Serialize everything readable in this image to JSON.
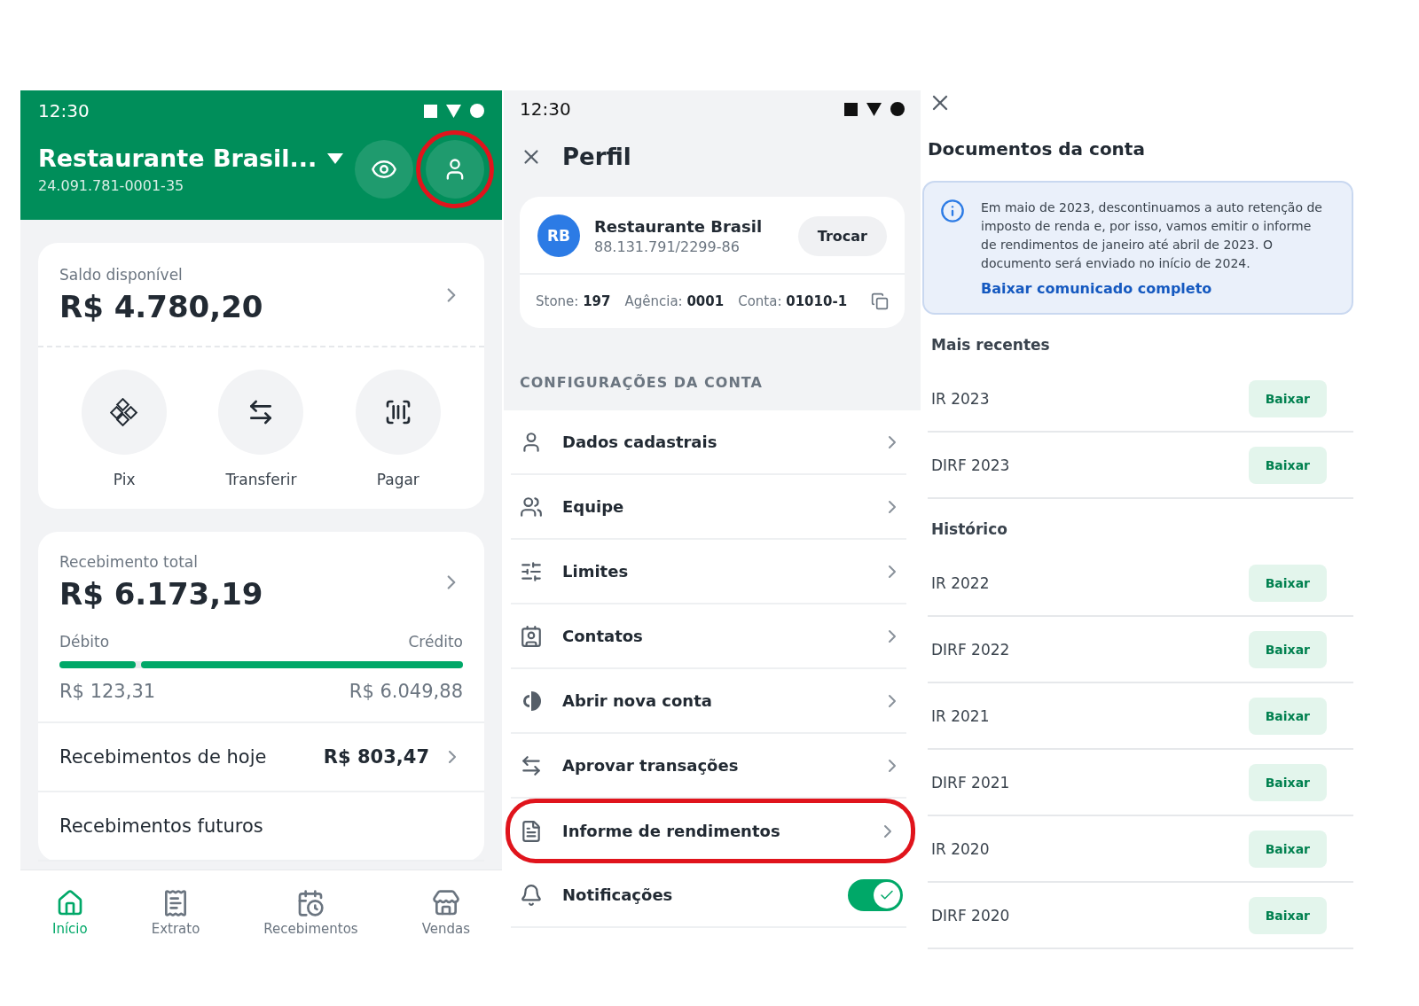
{
  "home": {
    "status_time": "12:30",
    "business_name": "Restaurante Brasil...",
    "document": "24.091.781-0001-35",
    "header_buttons": [
      {
        "kind": "eye",
        "highlighted": false
      },
      {
        "kind": "profile",
        "highlighted": true
      }
    ],
    "balance": {
      "label": "Saldo disponível",
      "amount": "R$ 4.780,20"
    },
    "actions": [
      {
        "kind": "pix",
        "label": "Pix"
      },
      {
        "kind": "transfer",
        "label": "Transferir"
      },
      {
        "kind": "pay",
        "label": "Pagar"
      }
    ],
    "receipts": {
      "label": "Recebimento total",
      "amount": "R$ 6.173,19",
      "debit_label": "Débito",
      "credit_label": "Crédito",
      "level": 0.19,
      "debit_amount": "R$ 123,31",
      "credit_amount": "R$ 6.049,88",
      "rows": [
        {
          "label": "Recebimentos de hoje",
          "value": "R$ 803,47"
        },
        {
          "label": "Recebimentos futuros"
        }
      ]
    },
    "nav": [
      {
        "kind": "home",
        "label": "Início",
        "selected": true
      },
      {
        "kind": "statement",
        "label": "Extrato",
        "selected": false
      },
      {
        "kind": "calendar",
        "label": "Recebimentos",
        "selected": false
      },
      {
        "kind": "store",
        "label": "Vendas",
        "selected": false
      }
    ]
  },
  "profile": {
    "status_time": "12:30",
    "title": "Perfil",
    "account": {
      "initials": "RB",
      "name": "Restaurante Brasil",
      "document": "88.131.791/2299-86",
      "switch_button": "Trocar",
      "details": [
        {
          "label": "Stone:",
          "value": "197"
        },
        {
          "label": "Agência:",
          "value": "0001"
        },
        {
          "label": "Conta:",
          "value": "01010-1"
        }
      ]
    },
    "section_title": "CONFIGURAÇÕES DA CONTA",
    "items": [
      {
        "kind": "link",
        "label": "Dados cadastrais",
        "highlighted": false
      },
      {
        "kind": "link",
        "label": "Equipe",
        "highlighted": false
      },
      {
        "kind": "link",
        "label": "Limites",
        "highlighted": false
      },
      {
        "kind": "link",
        "label": "Contatos",
        "highlighted": false
      },
      {
        "kind": "link",
        "label": "Abrir nova conta",
        "highlighted": false
      },
      {
        "kind": "link",
        "label": "Aprovar transações",
        "highlighted": false
      },
      {
        "kind": "link",
        "label": "Informe de rendimentos",
        "highlighted": true
      },
      {
        "kind": "toggle",
        "label": "Notificações",
        "on": true,
        "highlighted": false
      }
    ]
  },
  "documents": {
    "title": "Documentos da conta",
    "notice": {
      "text": "Em maio de 2023, descontinuamos a auto retenção de imposto de renda e, por isso, vamos emitir o informe de rendimentos de janeiro até abril de 2023. O documento será enviado no início de 2024.",
      "link": "Baixar comunicado completo"
    },
    "groups": [
      {
        "title": "Mais recentes",
        "rows": [
          {
            "name": "IR 2023",
            "button": "Baixar"
          },
          {
            "name": "DIRF 2023",
            "button": "Baixar"
          }
        ]
      },
      {
        "title": "Histórico",
        "rows": [
          {
            "name": "IR 2022",
            "button": "Baixar"
          },
          {
            "name": "DIRF 2022",
            "button": "Baixar"
          },
          {
            "name": "IR 2021",
            "button": "Baixar"
          },
          {
            "name": "DIRF 2021",
            "button": "Baixar"
          },
          {
            "name": "IR 2020",
            "button": "Baixar"
          },
          {
            "name": "DIRF 2020",
            "button": "Baixar"
          }
        ]
      }
    ]
  }
}
